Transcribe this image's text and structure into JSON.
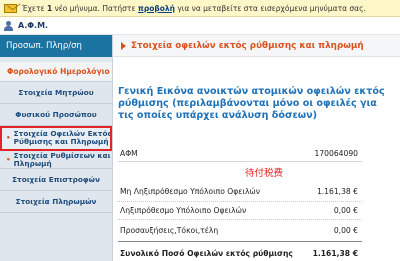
{
  "notification": {
    "prefix": "Έχετε",
    "count": "1",
    "text1": "νέο μήνυμα. Πατήστε",
    "link": "προβολή",
    "text2": "για να μεταβείτε στα εισερχόμενα μηνύματα σας."
  },
  "user": {
    "label": "Α.Φ.Μ."
  },
  "sidebar": {
    "header": "Προσωπ. Πληρ/ση",
    "category": "Φορολογικό Ημερολόγιο",
    "items": [
      {
        "label": "Στοιχεία Μητρώου"
      },
      {
        "label": "Φυσικού Προσώπου"
      },
      {
        "label": "Στοιχεία Οφειλών Εκτός Ρύθμισης και Πληρωμή"
      },
      {
        "label": "Στοιχεία Ρυθμίσεων και Πληρωμή"
      },
      {
        "label": "Στοιχεία Επιστροφών"
      },
      {
        "label": "Στοιχεία Πληρωμών"
      }
    ]
  },
  "main": {
    "header": "Στοιχεία οφειλών εκτός ρύθμισης και πληρωμή",
    "title": "Γενική Εικόνα ανοικτών ατομικών οφειλών εκτός ρύθμισης (περιλαμβάνονται μόνο οι οφειλές για τις οποίες υπάρχει ανάλυση δόσεων)",
    "afm": {
      "label": "ΑΦΜ",
      "value": "170064090"
    },
    "annotation": "待付税费",
    "rows": [
      {
        "label": "Μη Ληξιπρόθεσμο Υπόλοιπο Οφειλών",
        "value": "1.161,38 €"
      },
      {
        "label": "Ληξιπρόθεσμο Υπόλοιπο Οφειλών",
        "value": "0,00 €"
      },
      {
        "label": "Προσαυξήσεις,Τόκοι,τέλη",
        "value": "0,00 €"
      }
    ],
    "total": {
      "label": "Συνολικό Ποσό Οφειλών εκτός ρύθμισης",
      "value": "1.161,38 €"
    }
  }
}
